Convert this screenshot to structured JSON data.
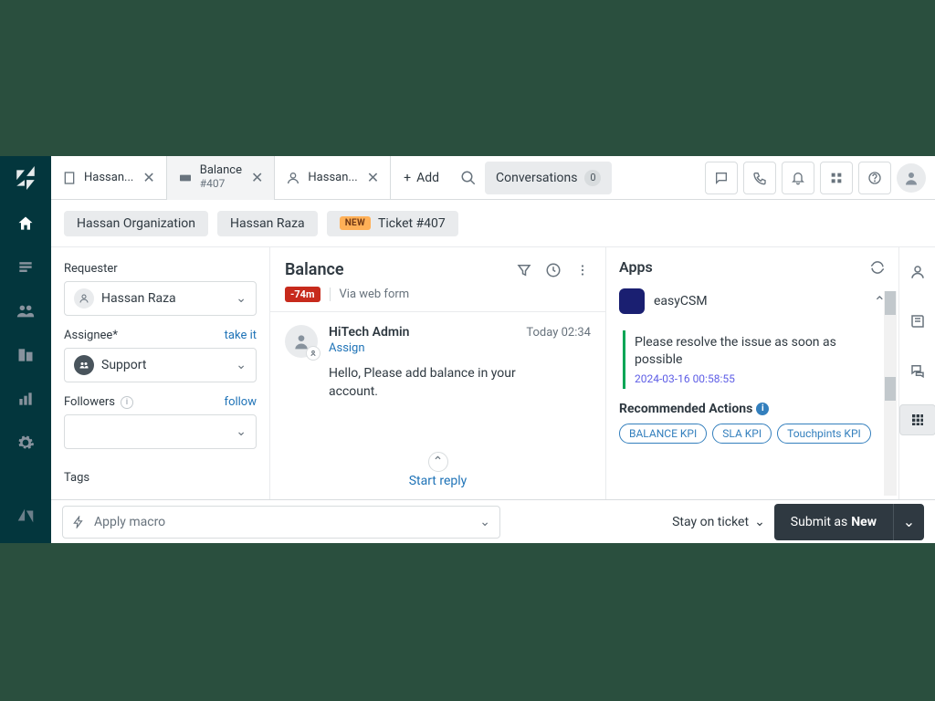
{
  "tabs": [
    {
      "label": "Hassan..."
    },
    {
      "title": "Balance",
      "sub": "#407"
    },
    {
      "label": "Hassan..."
    }
  ],
  "add_tab": "Add",
  "conversations": {
    "label": "Conversations",
    "count": "0"
  },
  "breadcrumbs": {
    "org": "Hassan Organization",
    "user": "Hassan Raza",
    "new": "NEW",
    "ticket": "Ticket #407"
  },
  "sidebar": {
    "requester_label": "Requester",
    "requester_value": "Hassan Raza",
    "assignee_label": "Assignee*",
    "assignee_action": "take it",
    "assignee_value": "Support",
    "followers_label": "Followers",
    "followers_action": "follow",
    "tags_label": "Tags"
  },
  "ticket": {
    "title": "Balance",
    "sla": "-74m",
    "via": "Via web form",
    "author": "HiTech Admin",
    "time": "Today 02:34",
    "assign": "Assign",
    "body": "Hello, Please add balance in your account.",
    "start_reply": "Start reply"
  },
  "apps": {
    "title": "Apps",
    "app_name": "easyCSM",
    "alert_text": "Please resolve the issue as soon as possible",
    "alert_time": "2024-03-16 00:58:55",
    "recs_title": "Recommended Actions",
    "recs": [
      "BALANCE KPI",
      "SLA KPI",
      "Touchpints KPI"
    ]
  },
  "footer": {
    "macro": "Apply macro",
    "stay": "Stay on ticket",
    "submit_prefix": "Submit as ",
    "submit_status": "New"
  }
}
